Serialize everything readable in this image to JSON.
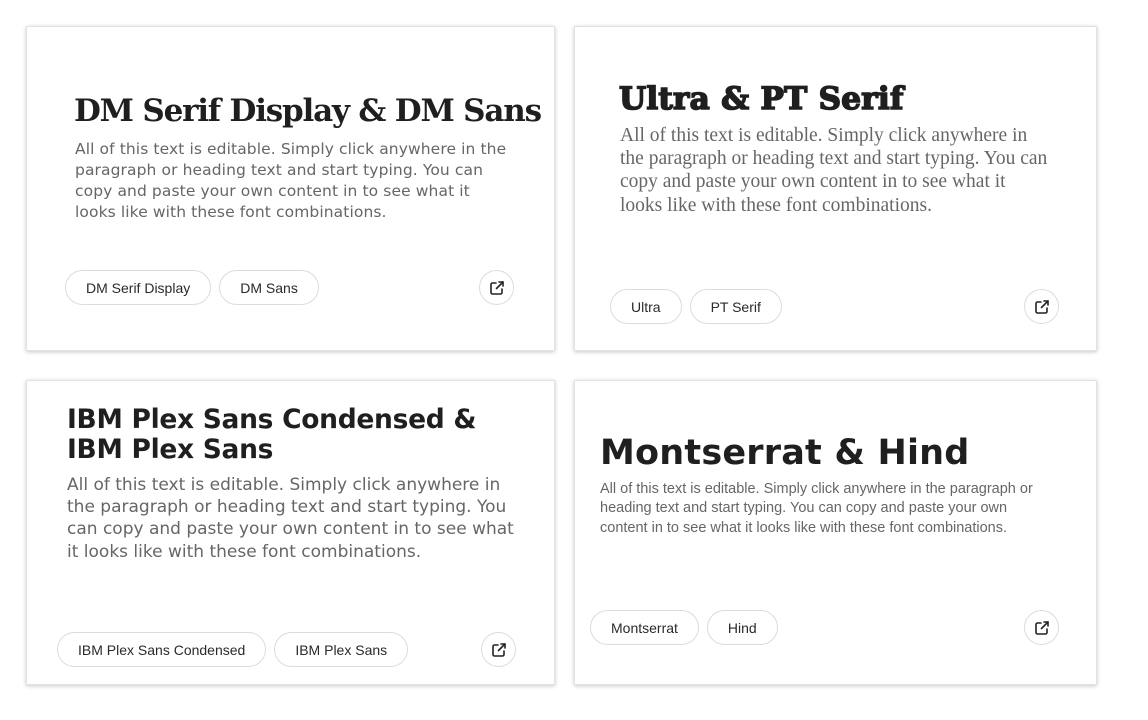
{
  "cards": [
    {
      "heading": "DM Serif Display & DM Sans",
      "paragraph": "All of this text is editable. Simply click anywhere in the paragraph or heading text and start typing. You can copy and paste your own content in to see what it looks like with these font combinations.",
      "tags": [
        "DM Serif Display",
        "DM Sans"
      ],
      "open_icon": "external-link-icon"
    },
    {
      "heading": "Ultra & PT Serif",
      "paragraph": "All of this text is editable. Simply click anywhere in the paragraph or heading text and start typing. You can copy and paste your own content in to see what it looks like with these font combinations.",
      "tags": [
        "Ultra",
        "PT Serif"
      ],
      "open_icon": "external-link-icon"
    },
    {
      "heading": "IBM Plex Sans Condensed & IBM Plex Sans",
      "paragraph": "All of this text is editable. Simply click anywhere in the paragraph or heading text and start typing. You can copy and paste your own content in to see what it looks like with these font combinations.",
      "tags": [
        "IBM Plex Sans Condensed",
        "IBM Plex Sans"
      ],
      "open_icon": "external-link-icon"
    },
    {
      "heading": "Montserrat & Hind",
      "paragraph": "All of this text is editable. Simply click anywhere in the paragraph or heading text and start typing. You can copy and paste your own content in to see what it looks like with these font combinations.",
      "tags": [
        "Montserrat",
        "Hind"
      ],
      "open_icon": "external-link-icon"
    }
  ],
  "colors": {
    "background": "#ffffff",
    "heading": "#1f1f1f",
    "paragraph": "#666666",
    "border": "#dcdcdc"
  }
}
